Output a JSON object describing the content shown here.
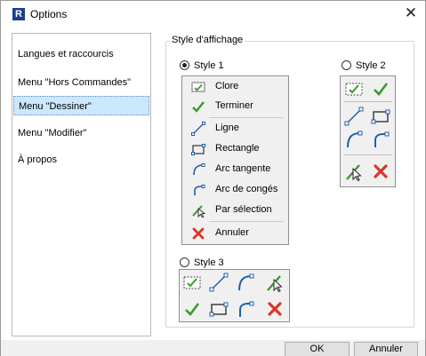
{
  "window": {
    "title": "Options",
    "app_icon_letter": "R",
    "close_glyph": "✕"
  },
  "sidebar": {
    "items": [
      {
        "label": "Langues et raccourcis",
        "selected": false
      },
      {
        "label": "Menu \"Hors Commandes\"",
        "selected": false
      },
      {
        "label": "Menu \"Dessiner\"",
        "selected": true
      },
      {
        "label": "Menu \"Modifier\"",
        "selected": false
      },
      {
        "label": "À propos",
        "selected": false
      }
    ]
  },
  "display_style": {
    "legend": "Style d'affichage",
    "style1": {
      "label": "Style 1",
      "checked": true,
      "items": [
        {
          "icon": "clore-icon",
          "label": "Clore"
        },
        {
          "icon": "checkmark-icon",
          "label": "Terminer"
        },
        {
          "icon": "line-icon",
          "label": "Ligne"
        },
        {
          "icon": "rectangle-icon",
          "label": "Rectangle"
        },
        {
          "icon": "arc-tangent-icon",
          "label": "Arc tangente"
        },
        {
          "icon": "fillet-arc-icon",
          "label": "Arc de congés"
        },
        {
          "icon": "pick-selection-icon",
          "label": "Par sélection"
        },
        {
          "icon": "cancel-x-icon",
          "label": "Annuler"
        }
      ]
    },
    "style2": {
      "label": "Style 2",
      "checked": false
    },
    "style3": {
      "label": "Style 3",
      "checked": false
    }
  },
  "buttons": {
    "ok": "OK",
    "cancel": "Annuler"
  },
  "colors": {
    "selection_bg": "#cce8ff",
    "check_green": "#3a9a2c",
    "line_blue": "#1f5fa8",
    "cancel_red": "#d9362b"
  }
}
